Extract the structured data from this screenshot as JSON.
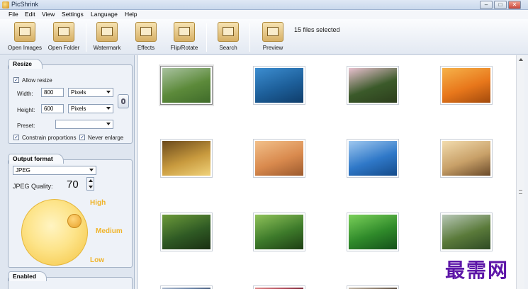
{
  "window": {
    "title": "PicShrink",
    "controls": [
      "–",
      "□",
      "✕"
    ]
  },
  "menu": [
    "File",
    "Edit",
    "View",
    "Settings",
    "Language",
    "Help"
  ],
  "toolbar": {
    "buttons": [
      {
        "label": "Open Images",
        "icon": "open-images-icon"
      },
      {
        "label": "Open Folder",
        "icon": "open-folder-icon"
      },
      {
        "label": "Watermark",
        "icon": "watermark-icon"
      },
      {
        "label": "Effects",
        "icon": "effects-icon"
      },
      {
        "label": "Flip/Rotate",
        "icon": "flip-rotate-icon"
      },
      {
        "label": "Search",
        "icon": "search-icon"
      },
      {
        "label": "Preview",
        "icon": "preview-icon"
      }
    ],
    "status": "15 files selected"
  },
  "resize": {
    "title": "Resize",
    "allow_resize": {
      "label": "Allow resize",
      "checked": true
    },
    "width": {
      "label": "Width:",
      "value": "800",
      "unit": "Pixels"
    },
    "height": {
      "label": "Height:",
      "value": "600",
      "unit": "Pixels"
    },
    "preset": {
      "label": "Preset:",
      "value": ""
    },
    "constrain": {
      "label": "Constrain proportions",
      "checked": true
    },
    "never_enlarge": {
      "label": "Never enlarge",
      "checked": true
    }
  },
  "output": {
    "title": "Output format",
    "format": "JPEG",
    "quality_label": "JPEG Quality:",
    "quality_value": "70",
    "dial_labels": {
      "high": "High",
      "medium": "Medium",
      "low": "Low"
    }
  },
  "enabled": {
    "title": "Enabled"
  },
  "thumbnails": [
    {
      "name": "river-meadow",
      "colors": [
        "#5c8a3a",
        "#a9c2a0",
        "#3f6b2a"
      ]
    },
    {
      "name": "whale-tail",
      "colors": [
        "#1d5f9a",
        "#3c8dd0",
        "#0f3d6a"
      ]
    },
    {
      "name": "pink-flowers",
      "colors": [
        "#3b5a2a",
        "#e9c1cf",
        "#2c3d1c"
      ]
    },
    {
      "name": "orange-flowers",
      "colors": [
        "#e8771b",
        "#f6b24a",
        "#a24a0c"
      ]
    },
    {
      "name": "autumn-tree",
      "colors": [
        "#c89a3e",
        "#6b4a1c",
        "#f0d27a"
      ]
    },
    {
      "name": "desert-dunes",
      "colors": [
        "#d98a4e",
        "#f2c08a",
        "#9c5a2e"
      ]
    },
    {
      "name": "blue-sea",
      "colors": [
        "#2f78c8",
        "#9fc8ef",
        "#154b8a"
      ]
    },
    {
      "name": "lone-tree",
      "colors": [
        "#c8a068",
        "#f2dcae",
        "#6a4a2a"
      ]
    },
    {
      "name": "toucan",
      "colors": [
        "#2f5a24",
        "#6c9a3a",
        "#1a2f12"
      ]
    },
    {
      "name": "forest-path",
      "colors": [
        "#3d7a2a",
        "#8fc25a",
        "#1e3e14"
      ]
    },
    {
      "name": "green-plants",
      "colors": [
        "#2f8a2a",
        "#7ad05a",
        "#14501a"
      ]
    },
    {
      "name": "waterfall",
      "colors": [
        "#5a7a3a",
        "#b8c8b8",
        "#2e4a24"
      ]
    },
    {
      "name": "row4-a",
      "colors": [
        "#6b84a8",
        "#aab8cc",
        "#3e5474"
      ]
    },
    {
      "name": "row4-b",
      "colors": [
        "#b04a5a",
        "#e08a8a",
        "#6e2030"
      ]
    },
    {
      "name": "row4-c",
      "colors": [
        "#8a7a6a",
        "#c4b8a8",
        "#4e4236"
      ]
    }
  ],
  "watermark_text": "最需网"
}
